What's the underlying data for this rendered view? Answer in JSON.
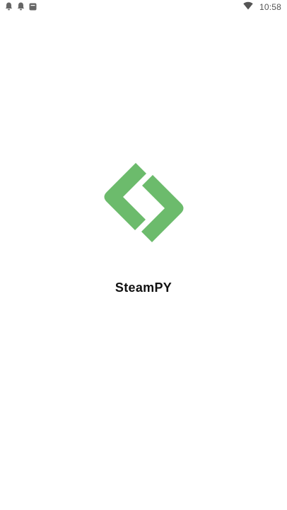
{
  "status_bar": {
    "time": "10:58",
    "left_icons": [
      "notification-bell-icon",
      "notification-bell-icon",
      "app-notification-icon"
    ],
    "right_icons": [
      "wifi-icon"
    ],
    "icon_color": "#666666"
  },
  "splash": {
    "app_name": "SteamPY",
    "logo_color": "#6cbb6c"
  }
}
